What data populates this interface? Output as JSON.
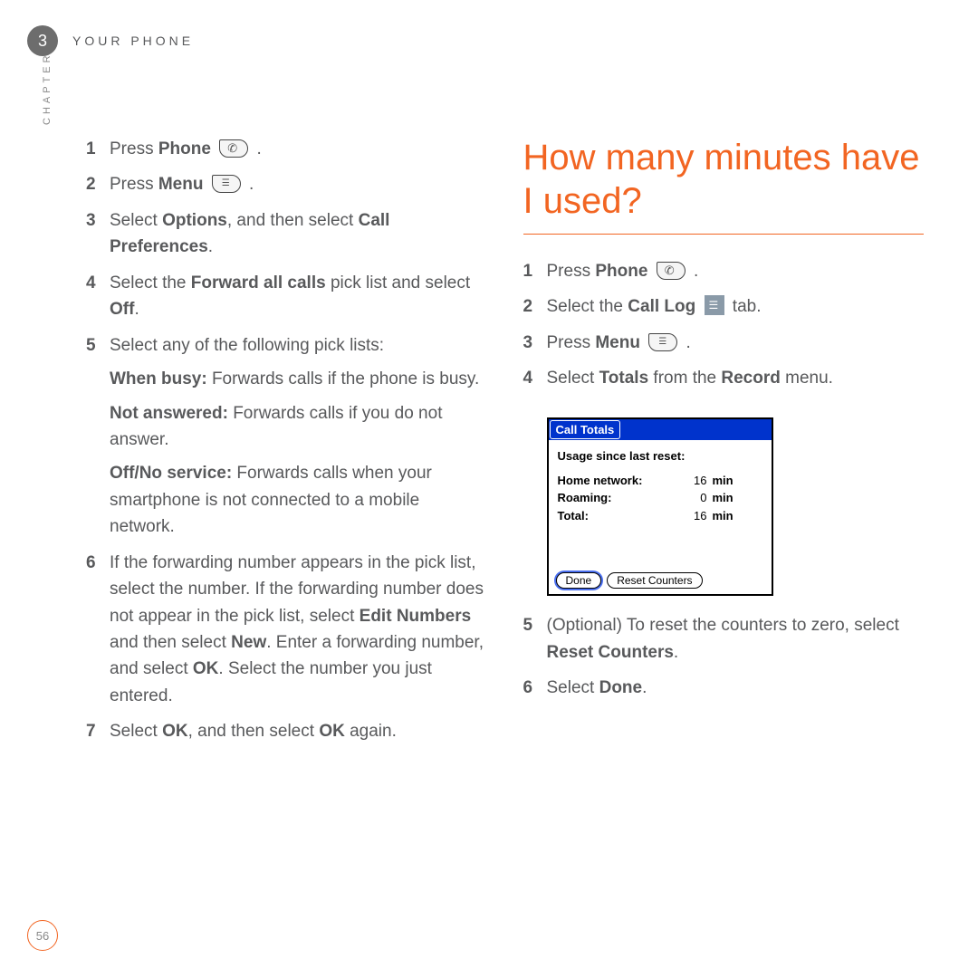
{
  "header": {
    "chapter_number": "3",
    "section_title": "YOUR PHONE",
    "side_label": "CHAPTER"
  },
  "left_steps": {
    "s1_a": "Press ",
    "s1_b": "Phone",
    "s1_c": " .",
    "s2_a": "Press ",
    "s2_b": "Menu",
    "s2_c": " .",
    "s3_a": "Select ",
    "s3_b": "Options",
    "s3_c": ", and then select ",
    "s3_d": "Call Preferences",
    "s3_e": ".",
    "s4_a": "Select the ",
    "s4_b": "Forward all calls",
    "s4_c": " pick list and select ",
    "s4_d": "Off",
    "s4_e": ".",
    "s5_a": "Select any of the following pick lists:",
    "s5_wb_label": "When busy:",
    "s5_wb_text": " Forwards calls if the phone is busy.",
    "s5_na_label": "Not answered:",
    "s5_na_text": " Forwards calls if you do not answer.",
    "s5_off_label": "Off/No service:",
    "s5_off_text": " Forwards calls when your smartphone is not connected to a mobile network.",
    "s6_a": "If the forwarding number appears in the pick list, select the number. If the forwarding number does not appear in the pick list, select ",
    "s6_b": "Edit Numbers",
    "s6_c": " and then select ",
    "s6_d": "New",
    "s6_e": ". Enter a forwarding number, and select ",
    "s6_f": "OK",
    "s6_g": ". Select the number you just entered.",
    "s7_a": "Select ",
    "s7_b": "OK",
    "s7_c": ", and then select ",
    "s7_d": "OK",
    "s7_e": " again."
  },
  "right": {
    "heading": "How many minutes have I used?",
    "s1_a": "Press ",
    "s1_b": "Phone",
    "s1_c": " .",
    "s2_a": "Select the ",
    "s2_b": "Call Log",
    "s2_c": " tab.",
    "s3_a": "Press ",
    "s3_b": "Menu",
    "s3_c": " .",
    "s4_a": "Select ",
    "s4_b": "Totals",
    "s4_c": " from the ",
    "s4_d": "Record",
    "s4_e": " menu.",
    "s5_a": "(Optional)  To reset the counters to zero, select ",
    "s5_b": "Reset Counters",
    "s5_c": ".",
    "s6_a": "Select ",
    "s6_b": "Done",
    "s6_c": "."
  },
  "call_totals": {
    "title": "Call Totals",
    "subtitle": "Usage since last reset:",
    "rows": [
      {
        "label": "Home network:",
        "value": "16",
        "unit": "min"
      },
      {
        "label": "Roaming:",
        "value": "0",
        "unit": "min"
      },
      {
        "label": "Total:",
        "value": "16",
        "unit": "min"
      }
    ],
    "done_btn": "Done",
    "reset_btn": "Reset Counters"
  },
  "page_number": "56"
}
